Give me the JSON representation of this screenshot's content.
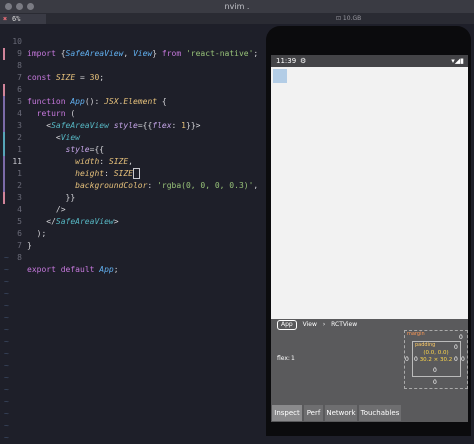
{
  "window": {
    "title": "nvim ."
  },
  "tabline": {
    "close_glyph": "✖",
    "percent": "6%",
    "right_text": "⊡ 10.GB"
  },
  "editor": {
    "lines": [
      {
        "num": "10",
        "code": "import {SafeAreaView, View} from 'react-native';"
      },
      {
        "num": "9",
        "code": ""
      },
      {
        "num": "8",
        "code": "const SIZE = 30;"
      },
      {
        "num": "7",
        "code": ""
      },
      {
        "num": "6",
        "code": "function App(): JSX.Element {"
      },
      {
        "num": "5",
        "code": "  return ("
      },
      {
        "num": "4",
        "code": "    <SafeAreaView style={{flex: 1}}>"
      },
      {
        "num": "3",
        "code": "      <View"
      },
      {
        "num": "2",
        "code": "        style={{"
      },
      {
        "num": "1",
        "code": "          width: SIZE,"
      },
      {
        "num": "11",
        "code": "          height: SIZE,"
      },
      {
        "num": "1",
        "code": "          backgroundColor: 'rgba(0, 0, 0, 0.3)',"
      },
      {
        "num": "2",
        "code": "        }}"
      },
      {
        "num": "3",
        "code": "      />"
      },
      {
        "num": "4",
        "code": "    </SafeAreaView>"
      },
      {
        "num": "5",
        "code": "  );"
      },
      {
        "num": "6",
        "code": "}"
      },
      {
        "num": "7",
        "code": ""
      },
      {
        "num": "8",
        "code": "export default App;"
      }
    ],
    "tilde": "~"
  },
  "phone": {
    "time": "11:39",
    "status_icons": "▾◢▮",
    "inspector": {
      "crumbs": [
        "App",
        "View",
        "RCTView"
      ],
      "flex_label": "flex:",
      "flex_value": "1",
      "margin_label": "margin",
      "padding_label": "padding",
      "content_pos": "(0.0, 0.0)",
      "content_size": "30.2 × 30.2",
      "values": {
        "m_top": "0",
        "m_right": "0",
        "m_bottom": "0",
        "m_left": "0",
        "p_top": "0",
        "p_right": "0",
        "p_bottom": "0",
        "p_left": "0"
      }
    },
    "tabs": [
      "Inspect",
      "Perf",
      "Network",
      "Touchables"
    ]
  },
  "colors": {
    "editor_bg": "#1e1f29",
    "box": "#b3cde6",
    "inspector_bg": "#5a5a5c"
  }
}
